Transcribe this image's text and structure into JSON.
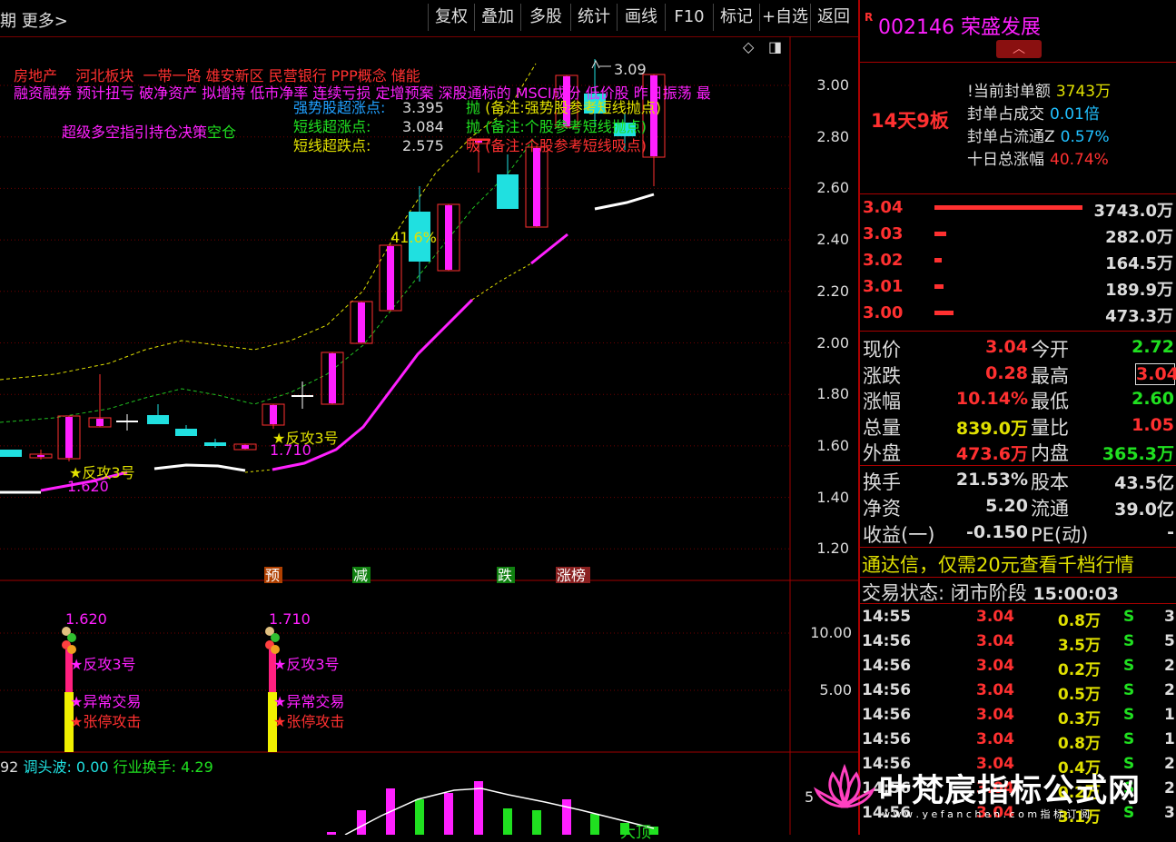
{
  "toolbar": {
    "left_label": "期 更多>",
    "buttons": [
      "复权",
      "叠加",
      "多股",
      "统计",
      "画线",
      "F10",
      "标记",
      "+自选",
      "返回"
    ]
  },
  "stock": {
    "badge": "R",
    "code": "002146",
    "name": "荣盛发展",
    "board_streak": "14天9板"
  },
  "seal": {
    "rows": [
      {
        "label": "!当前封单额",
        "value": "3743万",
        "color": "#e0e000"
      },
      {
        "label": "封单占成交",
        "value": "0.01倍",
        "color": "#20c0ff"
      },
      {
        "label": "封单占流通Z",
        "value": "0.57%",
        "color": "#20c0ff"
      },
      {
        "label": "十日总涨幅",
        "value": "40.74%",
        "color": "#ff3030"
      }
    ]
  },
  "orderbook": [
    {
      "price": "3.04",
      "volume": "3743.0万",
      "bar": 1.0
    },
    {
      "price": "3.03",
      "volume": "282.0万",
      "bar": 0.08
    },
    {
      "price": "3.02",
      "volume": "164.5万",
      "bar": 0.05
    },
    {
      "price": "3.01",
      "volume": "189.9万",
      "bar": 0.06
    },
    {
      "price": "3.00",
      "volume": "473.3万",
      "bar": 0.13
    }
  ],
  "quote": [
    {
      "l1": "现价",
      "v1": "3.04",
      "c1": "#ff3030",
      "l2": "今开",
      "v2": "2.72",
      "c2": "#20e020"
    },
    {
      "l1": "涨跌",
      "v1": "0.28",
      "c1": "#ff3030",
      "l2": "最高",
      "v2": "3.04",
      "c2": "#ff3030"
    },
    {
      "l1": "涨幅",
      "v1": "10.14%",
      "c1": "#ff3030",
      "l2": "最低",
      "v2": "2.60",
      "c2": "#20e020"
    },
    {
      "l1": "总量",
      "v1": "839.0万",
      "c1": "#e0e000",
      "l2": "量比",
      "v2": "1.05",
      "c2": "#ff3030"
    },
    {
      "l1": "外盘",
      "v1": "473.6万",
      "c1": "#ff3030",
      "l2": "内盘",
      "v2": "365.3万",
      "c2": "#20e020"
    }
  ],
  "fundamentals": [
    {
      "l1": "换手",
      "v1": "21.53%",
      "l2": "股本",
      "v2": "43.5亿"
    },
    {
      "l1": "净资",
      "v1": "5.20",
      "l2": "流通",
      "v2": "39.0亿"
    },
    {
      "l1": "收益(一)",
      "v1": "-0.150",
      "l2": "PE(动)",
      "v2": "-"
    }
  ],
  "promo": "通达信，仅需20元查看千档行情",
  "trade_status": {
    "label": "交易状态: 闭市阶段",
    "time": "15:00:03"
  },
  "ticks": [
    {
      "time": "14:55",
      "price": "3.04",
      "vol": "0.8万",
      "side": "S",
      "n": "3"
    },
    {
      "time": "14:56",
      "price": "3.04",
      "vol": "3.5万",
      "side": "S",
      "n": "5"
    },
    {
      "time": "14:56",
      "price": "3.04",
      "vol": "0.2万",
      "side": "S",
      "n": "2"
    },
    {
      "time": "14:56",
      "price": "3.04",
      "vol": "0.5万",
      "side": "S",
      "n": "2"
    },
    {
      "time": "14:56",
      "price": "3.04",
      "vol": "0.3万",
      "side": "S",
      "n": "1"
    },
    {
      "time": "14:56",
      "price": "3.04",
      "vol": "0.8万",
      "side": "S",
      "n": "1"
    },
    {
      "time": "14:56",
      "price": "3.04",
      "vol": "0.4万",
      "side": "S",
      "n": "2"
    },
    {
      "time": "14:56",
      "price": "3.04",
      "vol": "0.2万",
      "side": "S",
      "n": "2"
    },
    {
      "time": "14:56",
      "price": "3.04",
      "vol": "3.1万",
      "side": "S",
      "n": "3"
    }
  ],
  "chart": {
    "concept_line1": "房地产    河北板块  一带一路 雄安新区 民营银行 PPP概念 储能",
    "concept_line2": "融资融券 预计扭亏 破净资产 拟增持 低市净率 连续亏损 定增预案 深股通标的 MSCI成份 低价股 昨日振荡 最",
    "indicator_title": "超级多空指引持仓决策",
    "indicator_title2": "空仓",
    "levels": [
      {
        "label": "强势股超涨点:",
        "value": "3.395",
        "note_head": "抛",
        "note": "(备注:强势股参考短线抛点)",
        "color": "#20a0ff"
      },
      {
        "label": "短线超涨点:",
        "value": "3.084",
        "note_head": "抛",
        "note": "(备注:个股参考短线抛点)",
        "color": "#20e020"
      },
      {
        "label": "短线超跌点:",
        "value": "2.575",
        "note_head": "吸",
        "note": "(备注:个股参考短线吸点)",
        "color": "#e0e000"
      }
    ],
    "pct_label": "41.6%",
    "peak_label": "3.09",
    "attack_label": "★反攻3号",
    "low_labels": [
      "1.620",
      "1.710"
    ],
    "markers": [
      {
        "text": "预",
        "bg": "#b04000"
      },
      {
        "text": "减",
        "bg": "#108010"
      },
      {
        "text": "跌",
        "bg": "#108010"
      },
      {
        "text": "涨榜",
        "bg": "#a03030"
      }
    ],
    "main_y_ticks": [
      "3.00",
      "2.80",
      "2.60",
      "2.40",
      "2.20",
      "2.00",
      "1.80",
      "1.60",
      "1.40",
      "1.20"
    ],
    "sub_y_ticks": [
      "10.00",
      "5.00"
    ],
    "sub_signals": [
      "1.620",
      "1.710"
    ],
    "sub_labels": [
      "★反攻3号",
      "★异常交易",
      "★张停攻击"
    ],
    "bottom_bar": {
      "prefix": "92",
      "a_label": "调头波: 0.00",
      "b_label": "行业换手: 4.29"
    },
    "bottom_y_tick": "5",
    "bottom_word": "大顶"
  },
  "watermark": {
    "title": "叶梵宸指标公式网",
    "url": "w w w . y e f a n c h e n . c o m  指 标 订 阅"
  },
  "colors": {
    "up": "#ff3030",
    "down": "#20e0e0",
    "accent_magenta": "#ff20ff",
    "border": "#a00000"
  }
}
